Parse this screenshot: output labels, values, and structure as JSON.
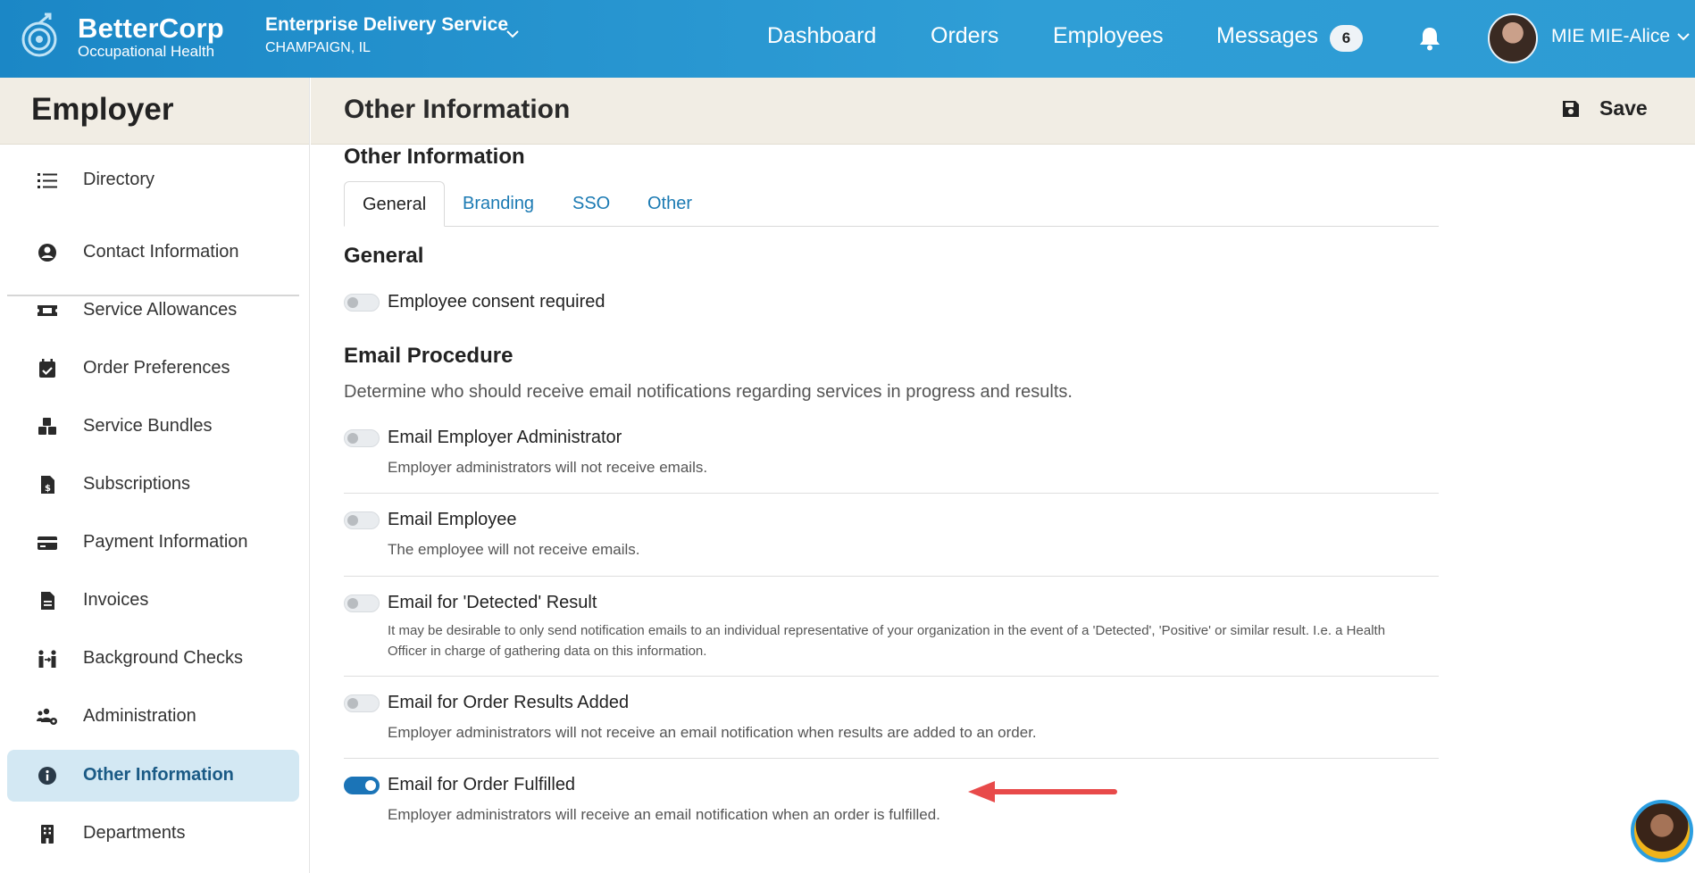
{
  "header": {
    "brand_name": "BetterCorp",
    "brand_sub": "Occupational Health",
    "org_name": "Enterprise Delivery Service",
    "org_location": "CHAMPAIGN, IL",
    "nav": [
      "Dashboard",
      "Orders",
      "Employees",
      "Messages"
    ],
    "messages_count": "6",
    "user_name": "MIE MIE-Alice",
    "colors": {
      "bar_start": "#1b87c6",
      "bar_end": "#2d9bd4"
    }
  },
  "sidebar": {
    "title": "Employer",
    "items": [
      {
        "label": "Directory",
        "icon": "list-icon"
      },
      {
        "label": "Contact Information",
        "icon": "user-circle-icon"
      },
      {
        "label": "Service Allowances",
        "icon": "ticket-icon"
      },
      {
        "label": "Order Preferences",
        "icon": "calendar-check-icon"
      },
      {
        "label": "Service Bundles",
        "icon": "cubes-icon"
      },
      {
        "label": "Subscriptions",
        "icon": "file-invoice-dollar-icon"
      },
      {
        "label": "Payment Information",
        "icon": "credit-card-icon"
      },
      {
        "label": "Invoices",
        "icon": "file-icon"
      },
      {
        "label": "Background Checks",
        "icon": "people-arrows-icon"
      },
      {
        "label": "Administration",
        "icon": "users-cog-icon"
      },
      {
        "label": "Other Information",
        "icon": "info-circle-icon"
      },
      {
        "label": "Departments",
        "icon": "building-icon"
      }
    ],
    "active_item": "Other Information"
  },
  "main": {
    "page_title": "Other Information",
    "save_label": "Save",
    "section_title": "Other Information",
    "tabs": [
      "General",
      "Branding",
      "SSO",
      "Other"
    ],
    "active_tab": "General",
    "general": {
      "heading": "General",
      "consent_label": "Employee consent required",
      "consent_on": false
    },
    "email": {
      "heading": "Email Procedure",
      "description": "Determine who should receive email notifications regarding services in progress and results.",
      "options": [
        {
          "label": "Email Employer Administrator",
          "help": "Employer administrators will not receive emails.",
          "on": false
        },
        {
          "label": "Email Employee",
          "help": "The employee will not receive emails.",
          "on": false
        },
        {
          "label": "Email for 'Detected' Result",
          "help": "It may be desirable to only send notification emails to an individual representative of your organization in the event of a 'Detected', 'Positive' or similar result. I.e. a Health Officer in charge of gathering data on this information.",
          "on": false
        },
        {
          "label": "Email for Order Results Added",
          "help": "Employer administrators will not receive an email notification when results are added to an order.",
          "on": false
        },
        {
          "label": "Email for Order Fulfilled",
          "help": "Employer administrators will receive an email notification when an order is fulfilled.",
          "on": true
        }
      ]
    },
    "colors": {
      "accent": "#1b74b7",
      "link": "#1b7ab3",
      "annotation_arrow": "#e84a4a"
    }
  }
}
